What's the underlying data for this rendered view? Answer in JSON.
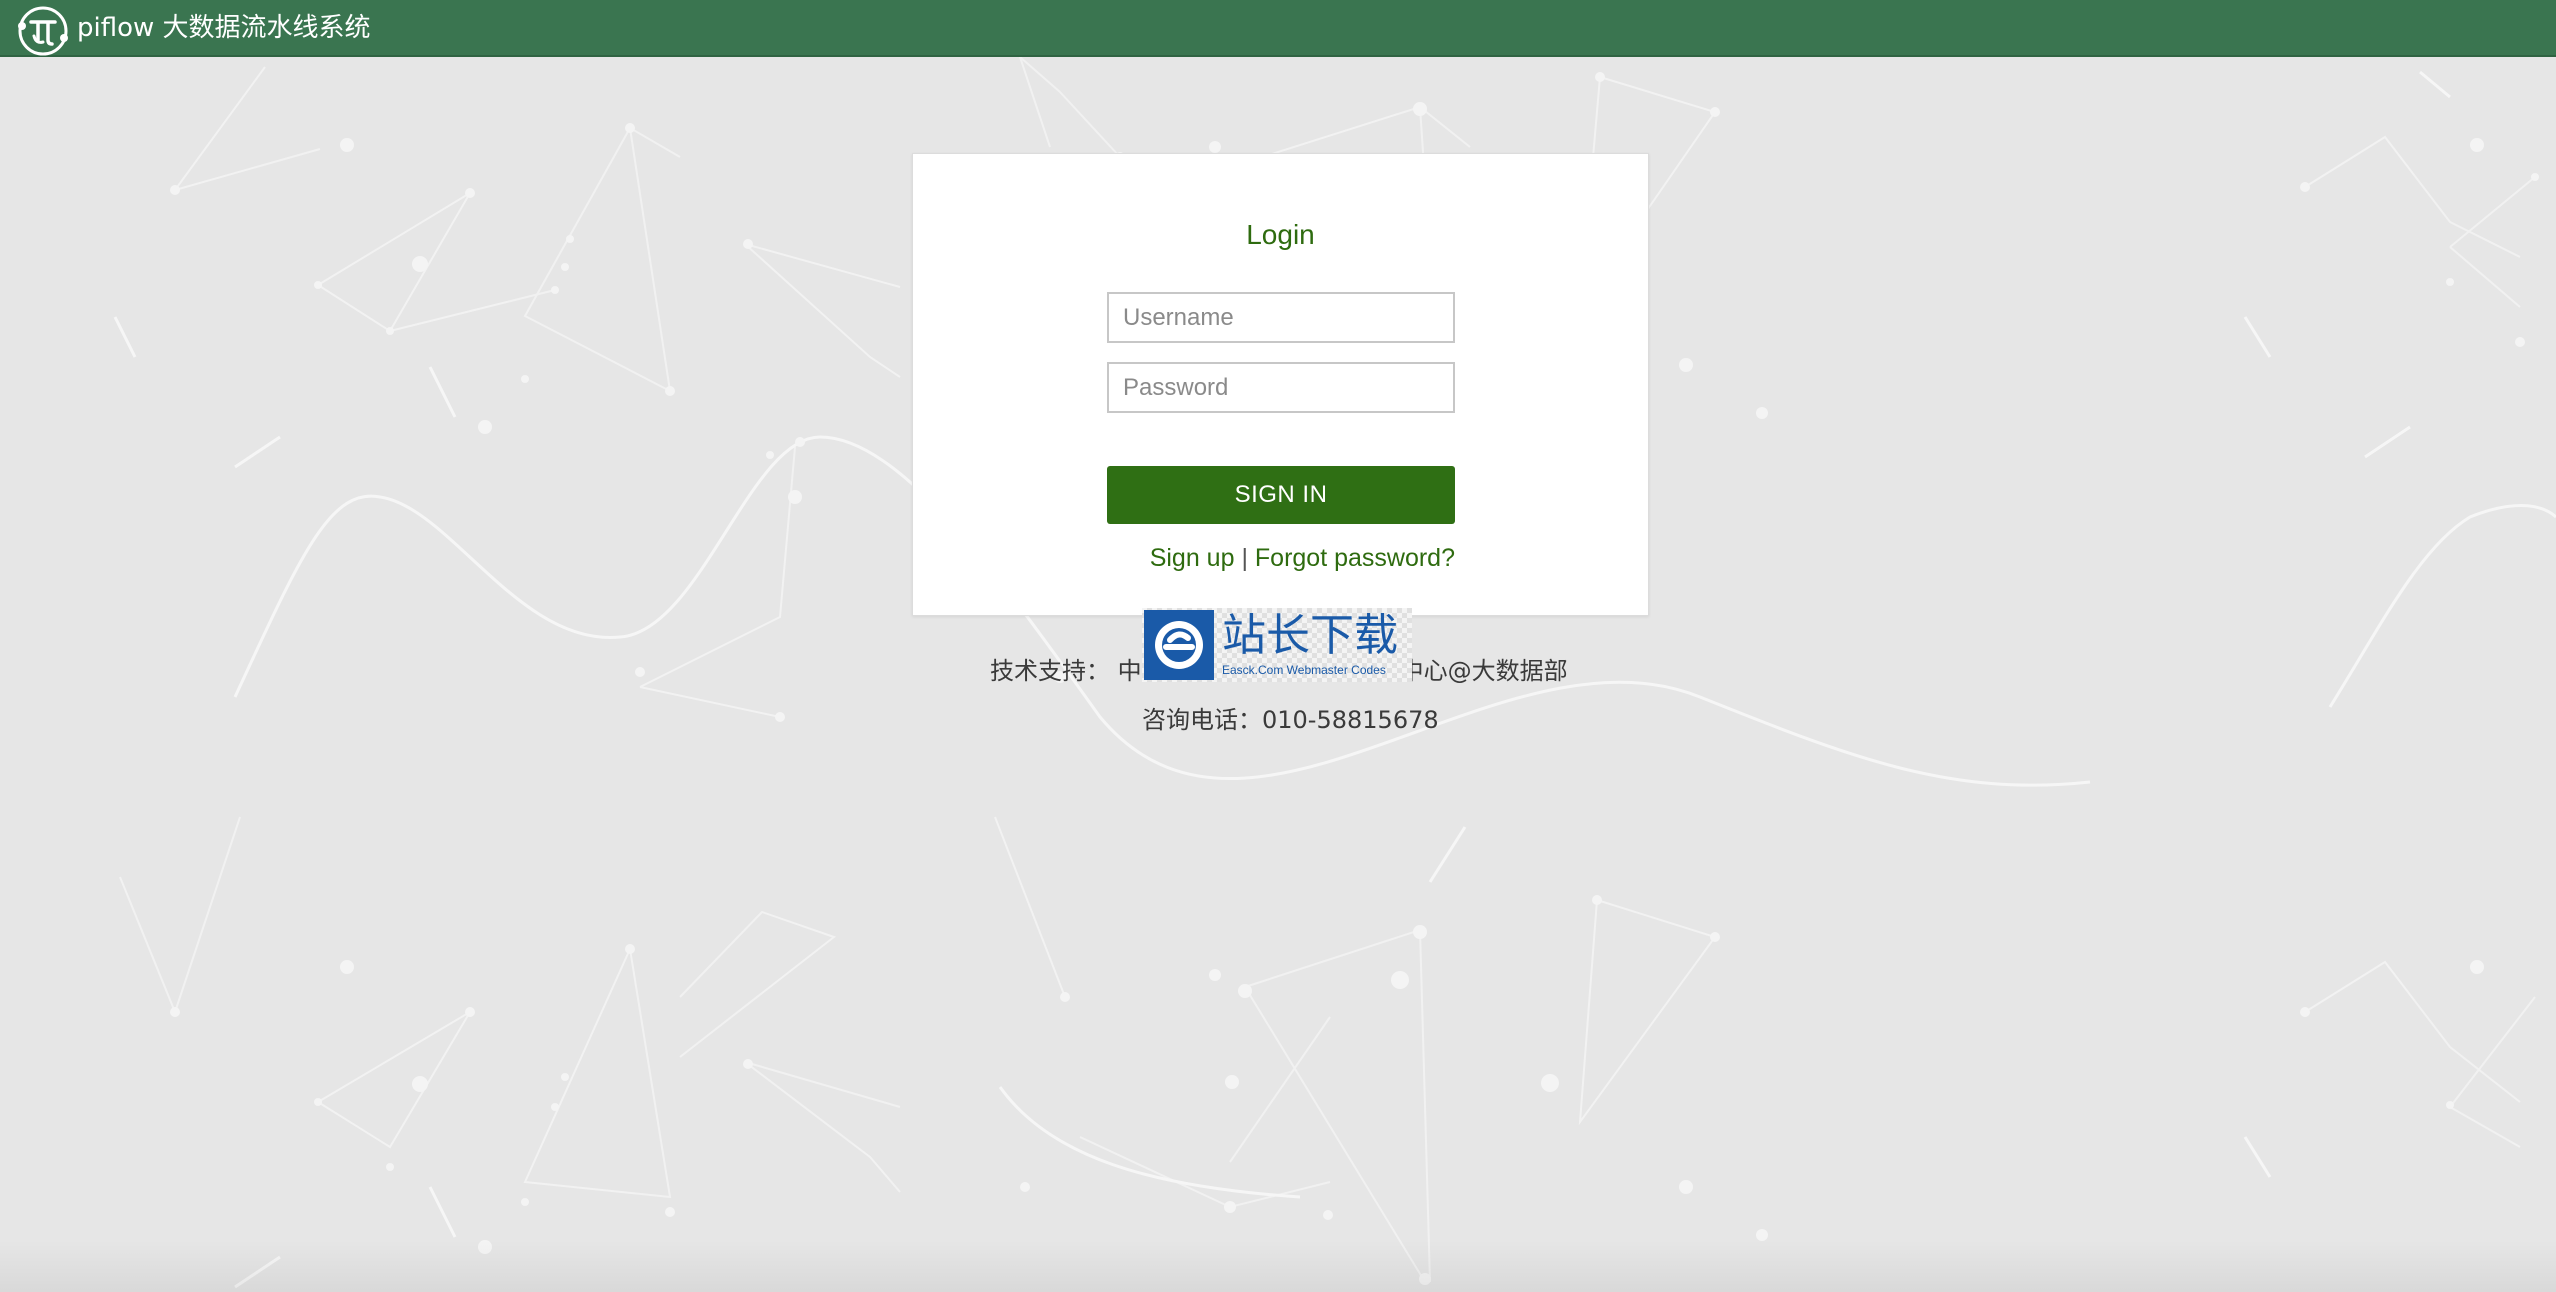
{
  "header": {
    "brand": "piflow 大数据流水线系统",
    "logo_icon": "piflow-logo-icon"
  },
  "login": {
    "title": "Login",
    "username_placeholder": "Username",
    "password_placeholder": "Password",
    "signin_label": "SIGN IN",
    "signup_label": "Sign up",
    "separator": "|",
    "forgot_label": "Forgot password?"
  },
  "footer": {
    "support_left": "技术支持： 中",
    "support_right": "中心@大数据部",
    "phone": "咨询电话：010-58815678"
  },
  "watermark": {
    "title": "站长下载",
    "subtitle": "Easck.Com Webmaster Codes",
    "icon": "easck-logo-icon"
  },
  "colors": {
    "header_bg": "#3a7550",
    "accent_green": "#2f6f14",
    "link_green": "#2e6b0f",
    "page_bg": "#e6e6e6",
    "watermark_blue": "#1a5aa8"
  }
}
